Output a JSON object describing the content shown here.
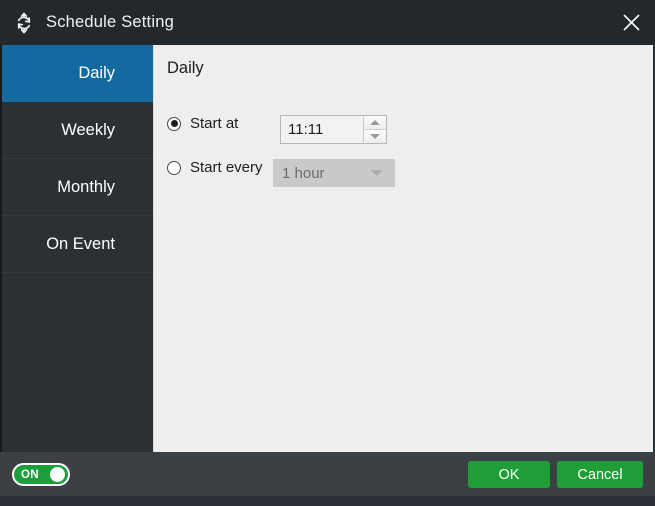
{
  "window": {
    "title": "Schedule Setting",
    "title_icon": "move-resize-icon",
    "close_icon": "close-icon"
  },
  "sidebar": {
    "items": [
      {
        "label": "Daily",
        "active": true
      },
      {
        "label": "Weekly",
        "active": false
      },
      {
        "label": "Monthly",
        "active": false
      },
      {
        "label": "On Event",
        "active": false
      }
    ]
  },
  "content": {
    "heading": "Daily",
    "start_at": {
      "label": "Start at",
      "selected": true,
      "time_value": "11:11",
      "time_placeholder": "hh:mm",
      "spinner_up_icon": "chevron-up-icon",
      "spinner_down_icon": "chevron-down-icon"
    },
    "start_every": {
      "label": "Start every",
      "selected": false,
      "interval_value": "1 hour",
      "dropdown_icon": "chevron-down-icon"
    }
  },
  "footer": {
    "toggle": {
      "label": "ON",
      "state": "on"
    },
    "ok_label": "OK",
    "cancel_label": "Cancel"
  },
  "colors": {
    "titlebar": "#23282d",
    "sidebar": "#2b3034",
    "sidebar_active": "#126aa0",
    "content_bg": "#eeeeee",
    "footer_bg": "#3a4044",
    "accent_green": "#1f9d36"
  }
}
